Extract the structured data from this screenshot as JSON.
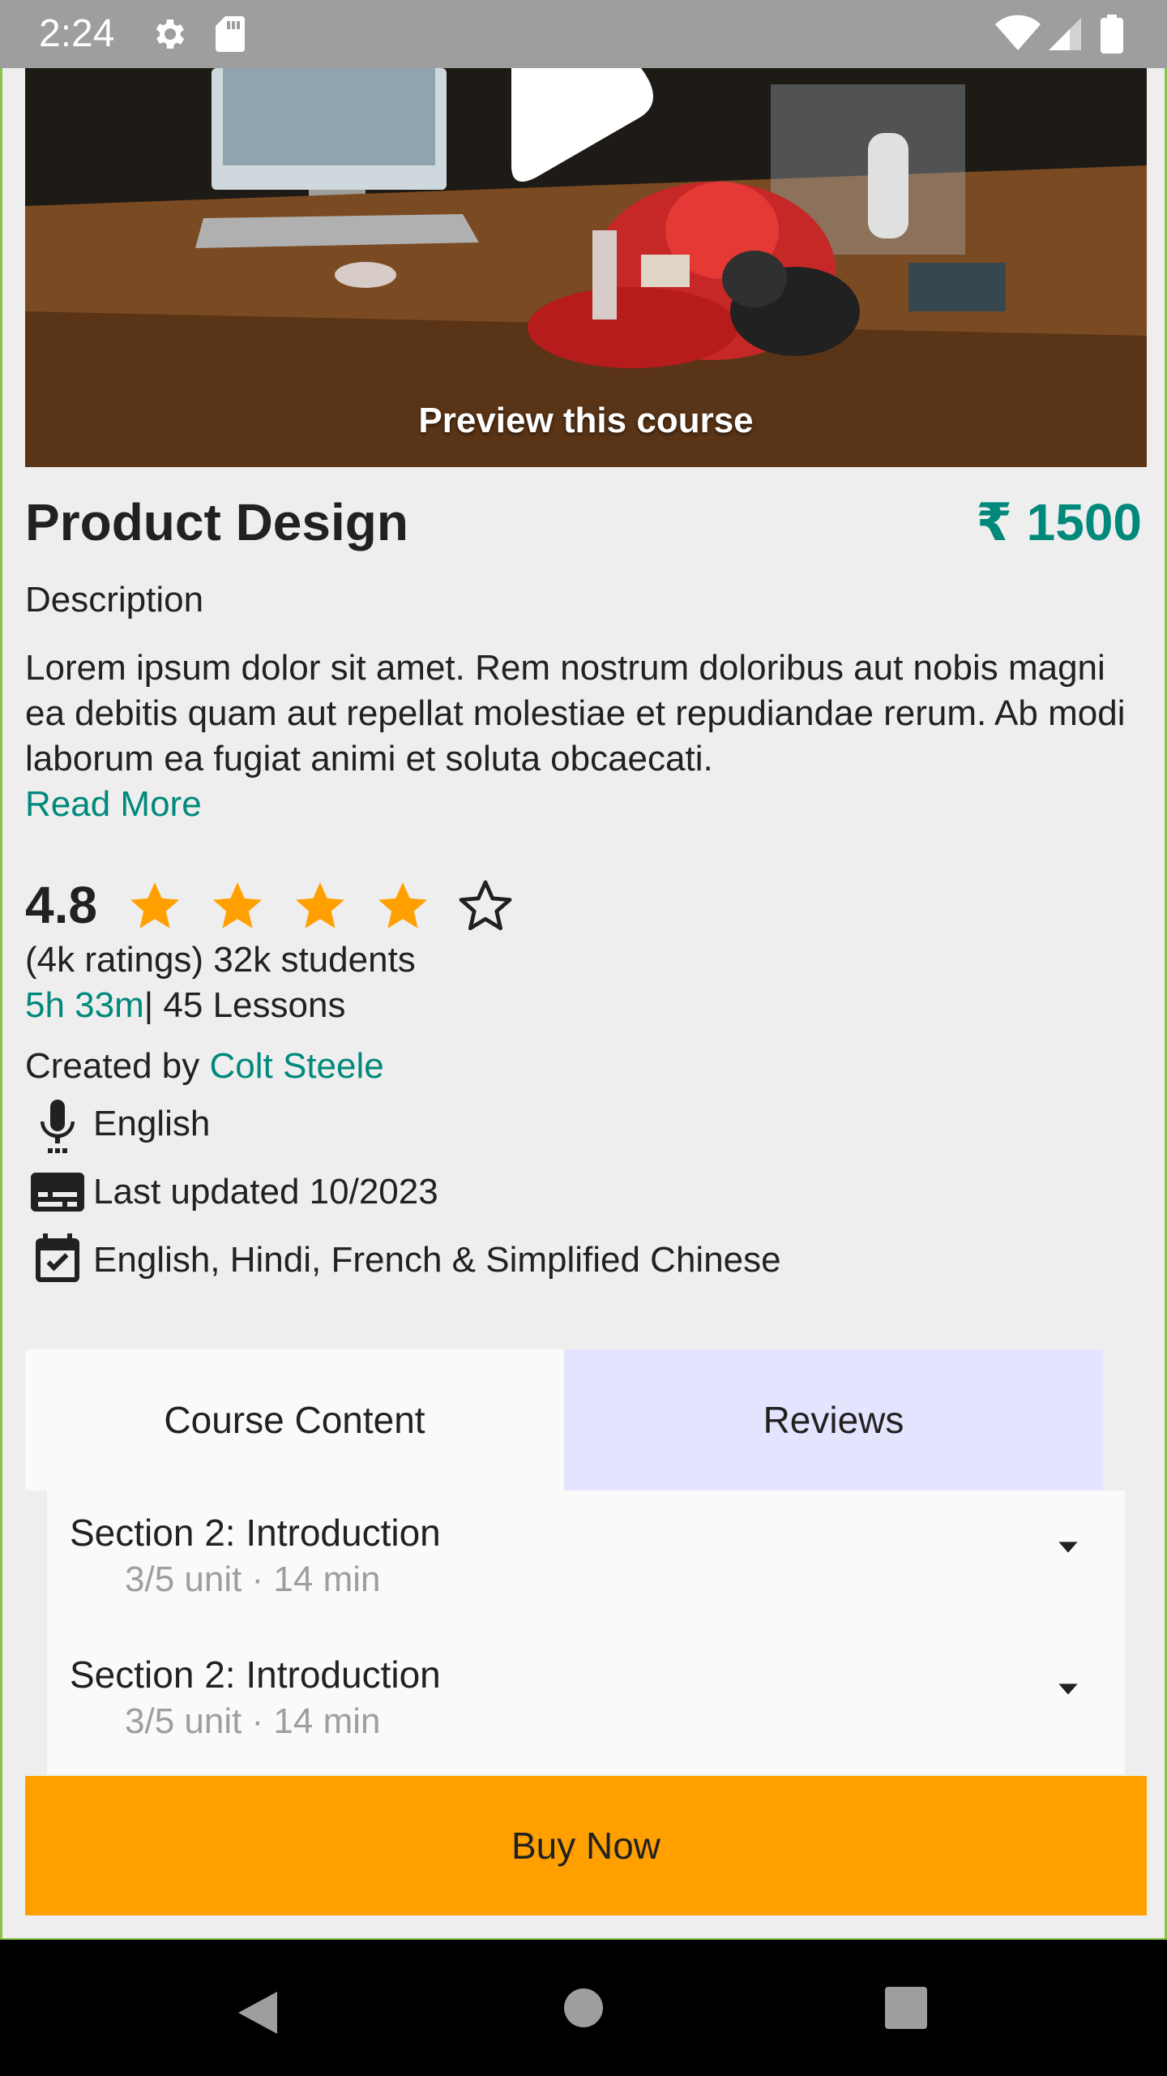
{
  "status_bar": {
    "time": "2:24",
    "left_icons": [
      "settings-icon",
      "sd-card-icon"
    ],
    "right_icons": [
      "wifi-icon",
      "signal-icon",
      "battery-icon"
    ]
  },
  "preview": {
    "label": "Preview this course",
    "play_icon": "play-icon"
  },
  "course": {
    "title": "Product Design",
    "price": "₹ 1500",
    "description_heading": "Description",
    "description": "Lorem ipsum dolor sit amet. Rem nostrum doloribus aut nobis magni ea debitis quam aut repellat molestiae et repudiandae rerum. Ab modi laborum ea fugiat animi et soluta obcaecati.",
    "read_more": "Read More"
  },
  "rating": {
    "value": "4.8",
    "stars_filled": 4,
    "stars_total": 5,
    "ratings_text": "(4k ratings) 32k students",
    "duration": "5h 33m",
    "lessons": "| 45 Lessons"
  },
  "creator": {
    "prefix": "Created by ",
    "name": "Colt Steele"
  },
  "meta": {
    "language": "English",
    "last_updated": "Last updated 10/2023",
    "subtitles": "English, Hindi, French & Simplified Chinese"
  },
  "tabs": {
    "course_content": "Course Content",
    "reviews": "Reviews"
  },
  "sections": [
    {
      "title": "Section 2: Introduction",
      "subtitle": "3/5 unit · 14 min"
    },
    {
      "title": "Section 2: Introduction",
      "subtitle": "3/5 unit · 14 min"
    }
  ],
  "buy_now": "Buy Now",
  "colors": {
    "accent": "#00897b",
    "star": "#ffa000",
    "buy_button": "#ffa000",
    "reviews_tab": "#e4e4ff"
  }
}
